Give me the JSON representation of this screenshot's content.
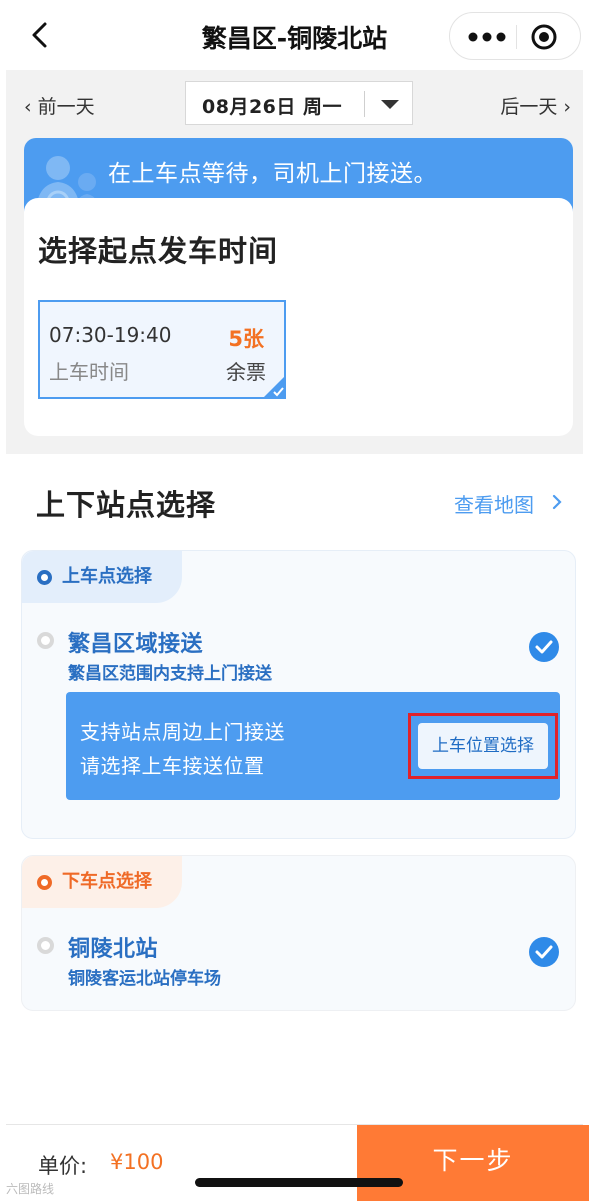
{
  "navbar": {
    "title": "繁昌区-铜陵北站",
    "back_icon": "chevron-left-icon",
    "more_icon": "more-dots-icon",
    "close_icon": "target-circle-icon"
  },
  "date_bar": {
    "prev_label": "‹ 前一天",
    "next_label": "后一天 ›",
    "selected_date": "08月26日  周一"
  },
  "banner": {
    "text": "在上车点等待，司机上门接送。",
    "icon": "driver-avatar-icon"
  },
  "departure": {
    "title": "选择起点发车时间",
    "options": [
      {
        "time_range": "07:30-19:40",
        "time_label": "上车时间",
        "tickets": "5张",
        "tickets_label": "余票",
        "selected": true
      }
    ]
  },
  "stations": {
    "title": "上下站点选择",
    "view_map": "查看地图",
    "pickup": {
      "tag": "上车点选择",
      "option_name": "繁昌区域接送",
      "option_sub": "繁昌区范围内支持上门接送",
      "info_line1": "支持站点周边上门接送",
      "info_line2": "请选择上车接送位置",
      "button": "上车位置选择"
    },
    "dropoff": {
      "tag": "下车点选择",
      "option_name": "铜陵北站",
      "option_sub": "铜陵客运北站停车场"
    }
  },
  "footer": {
    "price_label": "单价:",
    "price_value": "¥100",
    "next_button": "下一步"
  },
  "watermark": "六图路线"
}
